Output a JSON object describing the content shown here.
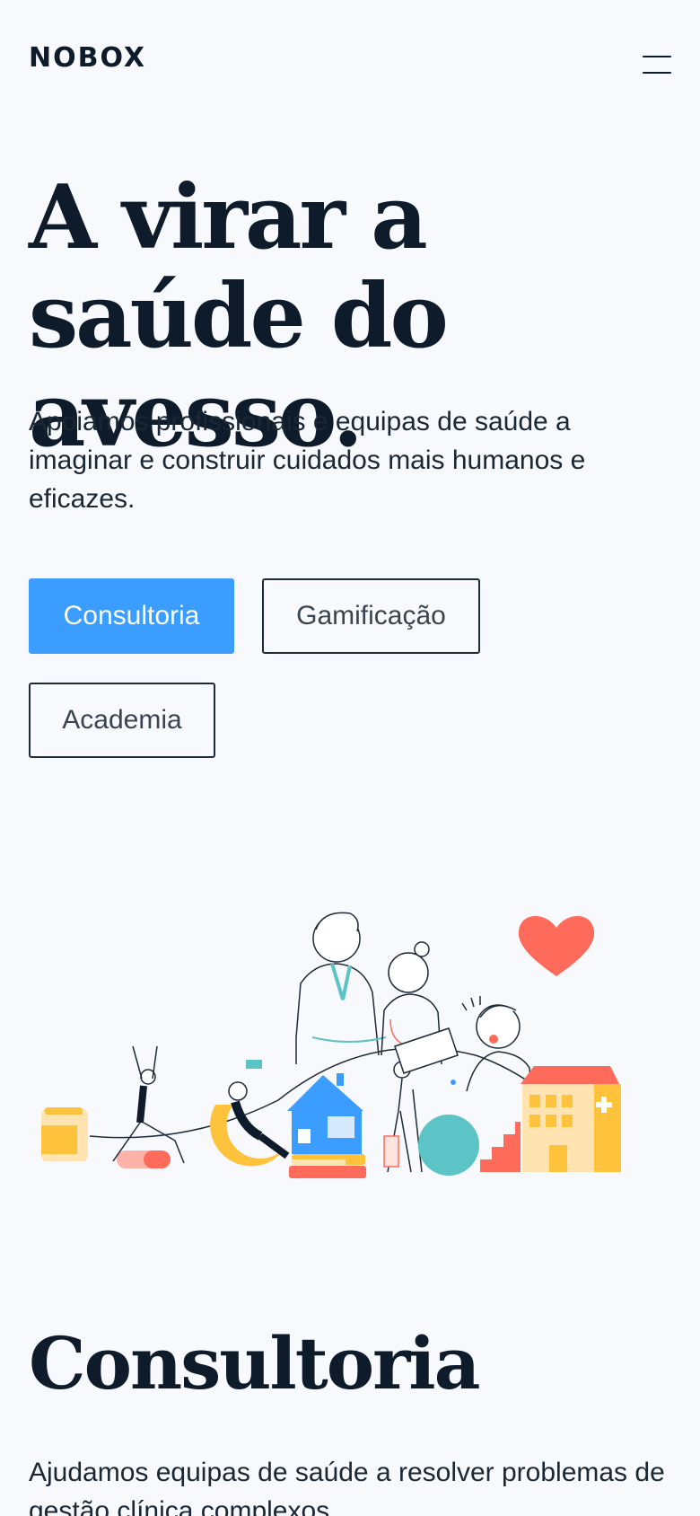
{
  "header": {
    "logo": "NOBOX",
    "menu_icon": "hamburger-menu-icon"
  },
  "hero": {
    "title": "A virar a saúde do avesso.",
    "text": "Apoiamos profissionais e equipas de saúde a imaginar e construir cuidados mais humanos e eficazes.",
    "buttons": [
      {
        "label": "Consultoria"
      },
      {
        "label": "Gamificação"
      },
      {
        "label": "Academia"
      }
    ]
  },
  "section": {
    "title": "Consultoria",
    "text": "Ajudamos equipas de saúde a resolver problemas de gestão clínica complexos."
  },
  "colors": {
    "accent": "#3b9dff",
    "text": "#0d1b2a",
    "background": "#f8f9fd",
    "yellow": "#ffc23c",
    "coral": "#ff6b5a",
    "teal": "#5cc3c6",
    "blue": "#3b9dff"
  }
}
